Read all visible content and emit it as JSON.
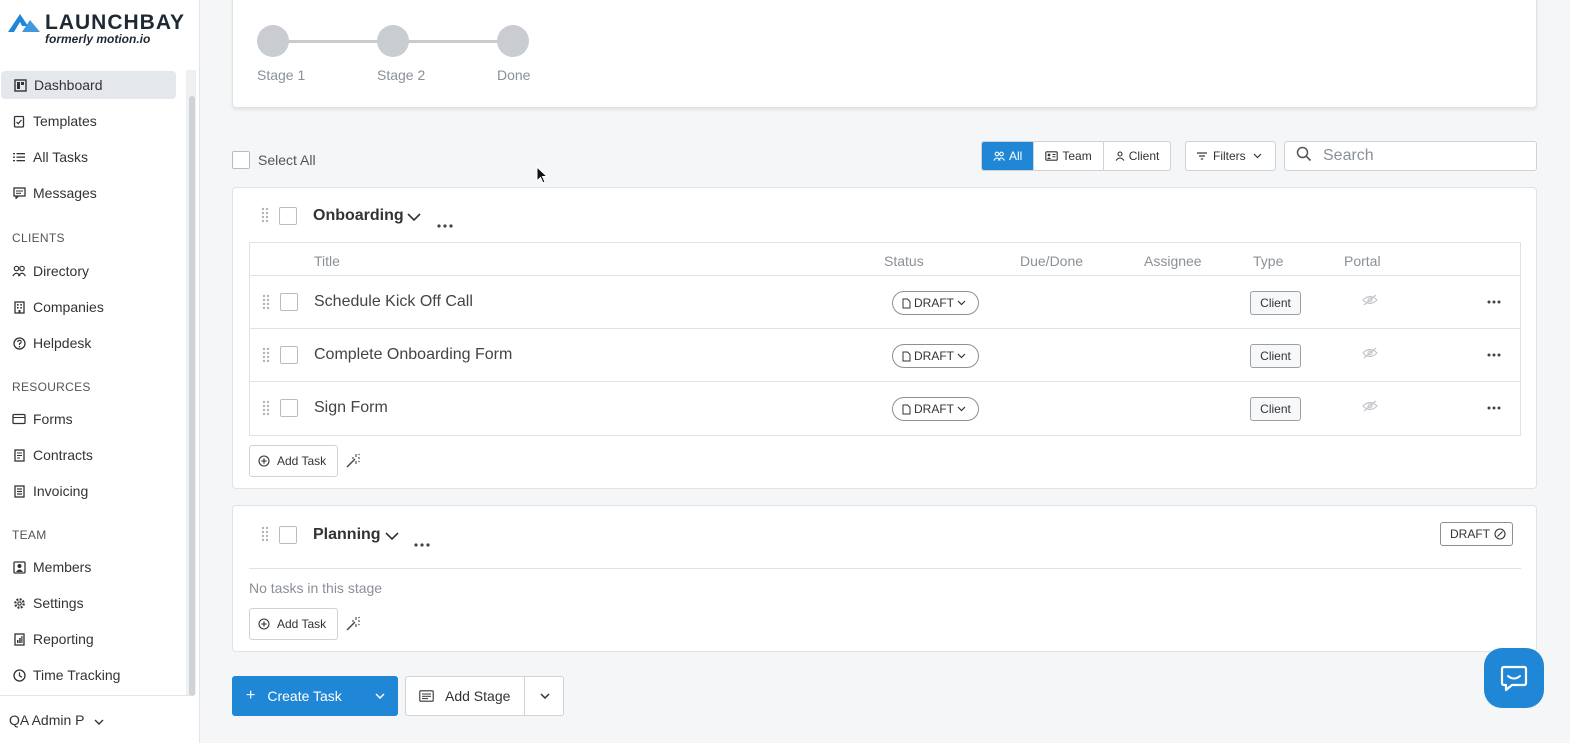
{
  "brand": {
    "name": "LAUNCHBAY",
    "subtitle": "formerly motion.io",
    "color": "#1f87d6"
  },
  "sidebar": {
    "items": [
      {
        "label": "Dashboard",
        "icon": "dashboard-icon",
        "active": true
      },
      {
        "label": "Templates",
        "icon": "templates-icon"
      },
      {
        "label": "All Tasks",
        "icon": "list-icon"
      },
      {
        "label": "Messages",
        "icon": "messages-icon"
      }
    ],
    "clients_heading": "CLIENTS",
    "clients": [
      {
        "label": "Directory",
        "icon": "people-icon"
      },
      {
        "label": "Companies",
        "icon": "building-icon"
      },
      {
        "label": "Helpdesk",
        "icon": "help-circle-icon"
      }
    ],
    "resources_heading": "RESOURCES",
    "resources": [
      {
        "label": "Forms",
        "icon": "form-icon"
      },
      {
        "label": "Contracts",
        "icon": "contract-icon"
      },
      {
        "label": "Invoicing",
        "icon": "invoice-icon"
      }
    ],
    "team_heading": "TEAM",
    "team": [
      {
        "label": "Members",
        "icon": "member-icon"
      },
      {
        "label": "Settings",
        "icon": "gear-icon"
      },
      {
        "label": "Reporting",
        "icon": "report-icon"
      },
      {
        "label": "Time Tracking",
        "icon": "clock-icon"
      }
    ],
    "user": "QA Admin P"
  },
  "progress": {
    "stages": [
      "Stage 1",
      "Stage 2",
      "Done"
    ]
  },
  "toolbar": {
    "select_all": "Select All",
    "views": [
      "All",
      "Team",
      "Client"
    ],
    "active_view": "All",
    "filters": "Filters",
    "search_placeholder": "Search"
  },
  "columns": {
    "title": "Title",
    "status": "Status",
    "due": "Due/Done",
    "assignee": "Assignee",
    "type": "Type",
    "portal": "Portal"
  },
  "stages": [
    {
      "name": "Onboarding",
      "tasks": [
        {
          "title": "Schedule Kick Off Call",
          "status": "DRAFT",
          "type": "Client"
        },
        {
          "title": "Complete Onboarding Form",
          "status": "DRAFT",
          "type": "Client"
        },
        {
          "title": "Sign Form",
          "status": "DRAFT",
          "type": "Client"
        }
      ],
      "add_task": "Add Task"
    },
    {
      "name": "Planning",
      "badge": "DRAFT",
      "empty_text": "No tasks in this stage",
      "add_task": "Add Task"
    }
  ],
  "actions": {
    "create_task": "Create Task",
    "add_stage": "Add Stage"
  }
}
